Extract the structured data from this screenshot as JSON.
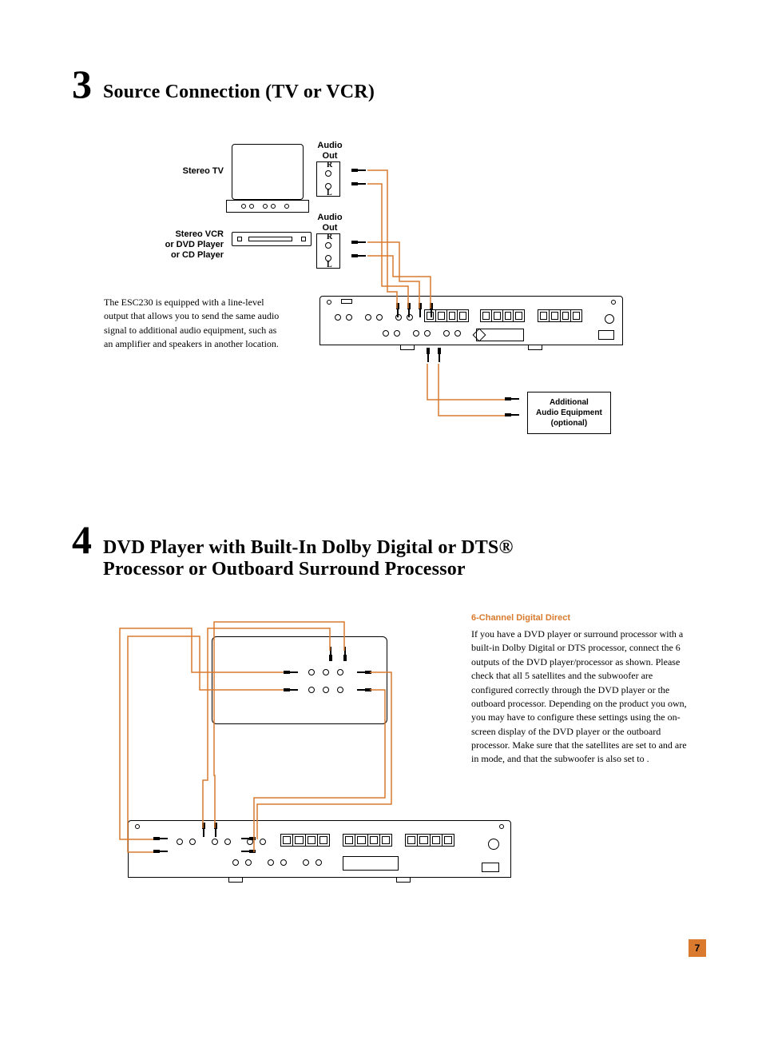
{
  "section3": {
    "number": "3",
    "title": "Source Connection (TV or VCR)",
    "labels": {
      "stereo_tv": "Stereo TV",
      "stereo_vcr": "Stereo VCR\nor DVD Player\nor CD Player",
      "audio_out_top": "Audio\nOut",
      "audio_out_bottom": "Audio\nOut",
      "r_top": "R",
      "l_top": "L",
      "r_bot": "R",
      "l_bot": "L"
    },
    "body_text": "The ESC230 is equipped with a line-level output that allows you to send the same audio signal to additional audio equipment, such as an amplifier and speakers in another location.",
    "optional_box": "Additional\nAudio Equipment\n(optional)"
  },
  "section4": {
    "number": "4",
    "title": "DVD Player with Built-In Dolby Digital or DTS® Processor or Outboard Surround Processor",
    "subhead": "6-Channel Digital Direct",
    "body_text": "If you have a DVD player or surround processor with a built-in Dolby Digital or DTS processor, connect the 6 outputs of the DVD player/processor as shown. Please check that all 5 satellites and the subwoofer are configured correctly through the DVD player or the outboard processor. Depending on the product you own, you may have to configure these settings using the on-screen display of the DVD player or the outboard processor. Make sure that the satellites are set to     and are in mode, and that the subwoofer is also set to    ."
  },
  "page_number": "7"
}
